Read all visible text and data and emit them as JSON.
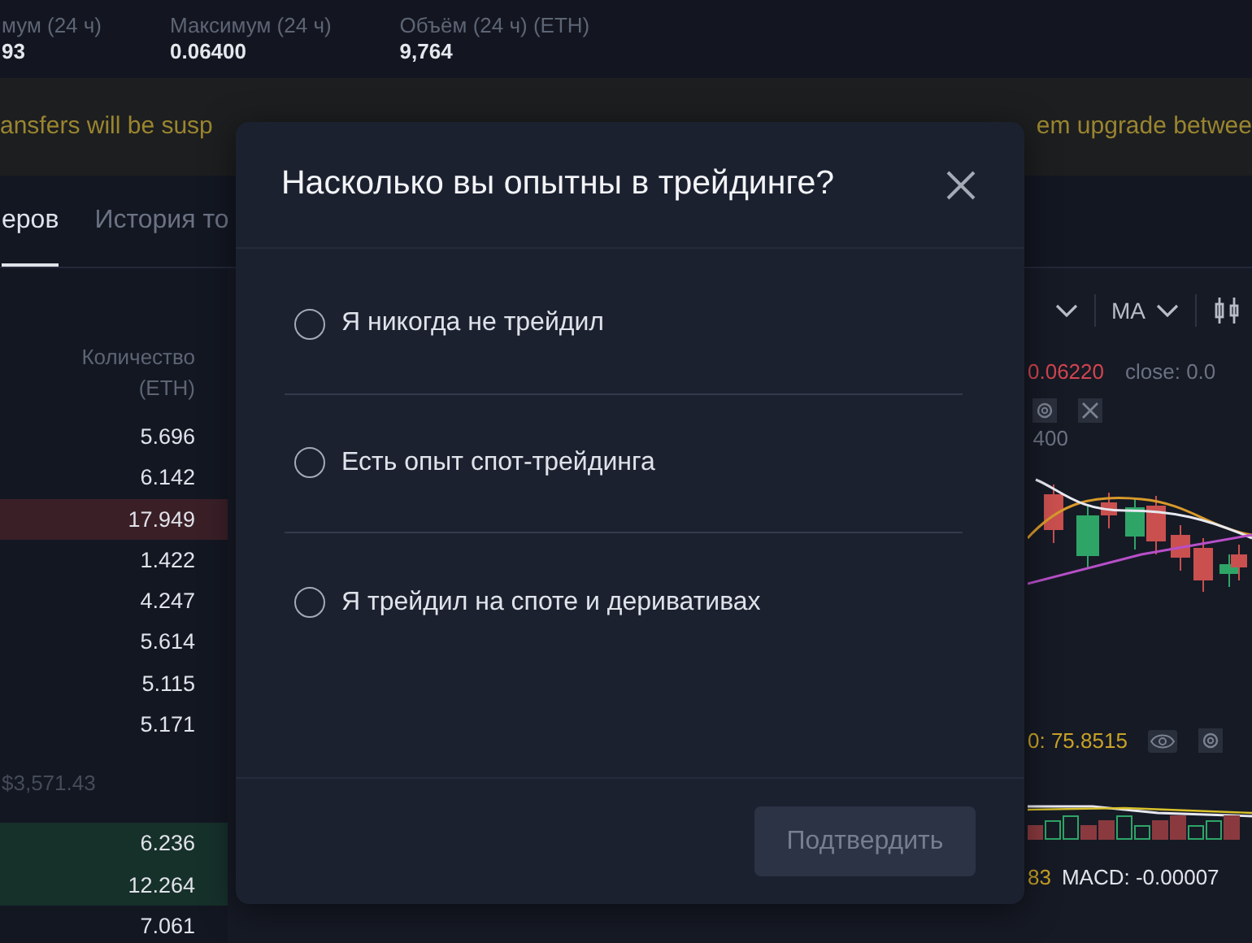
{
  "stats": [
    {
      "label": "мум (24 ч)",
      "value": "93"
    },
    {
      "label": "Максимум (24 ч)",
      "value": "0.06400"
    },
    {
      "label": "Объём (24 ч) (ETH)",
      "value": "9,764"
    }
  ],
  "banner": {
    "left": "ansfers will be susp",
    "right": "em upgrade betwee"
  },
  "tabs": [
    {
      "label": "еров",
      "selected": true
    },
    {
      "label": "История то",
      "selected": false
    }
  ],
  "order_book": {
    "header": "Количество (ETH)",
    "asks": [
      {
        "amount": "5.696",
        "highlighted": false
      },
      {
        "amount": "6.142",
        "highlighted": false
      },
      {
        "amount": "17.949",
        "highlighted": true
      },
      {
        "amount": "1.422",
        "highlighted": false
      },
      {
        "amount": "4.247",
        "highlighted": false
      },
      {
        "amount": "5.614",
        "highlighted": false
      },
      {
        "amount": "5.115",
        "highlighted": false
      },
      {
        "amount": "5.171",
        "highlighted": false
      }
    ],
    "mid_price": "$3,571.43",
    "bids": [
      {
        "amount": "6.236",
        "highlighted": true
      },
      {
        "amount": "12.264",
        "highlighted": true
      },
      {
        "amount": "7.061",
        "highlighted": false
      }
    ]
  },
  "chart": {
    "toolbar": [
      {
        "kind": "caret"
      },
      {
        "kind": "dropdown",
        "label": "MA"
      },
      {
        "kind": "candles"
      }
    ],
    "ohlc_value": "0.06220",
    "ohlc_next": "close: 0.0",
    "axis_label": "400",
    "rsi_label": "0: 75.8515",
    "macd_prefix": "83",
    "macd_label": "MACD: -0.00007"
  },
  "modal": {
    "title": "Насколько вы опытны в трейдинге?",
    "options": [
      {
        "label": "Я никогда не трейдил",
        "selected": false
      },
      {
        "label": "Есть опыт спот-трейдинга",
        "selected": false
      },
      {
        "label": "Я трейдил на споте и деривативах",
        "selected": false
      }
    ],
    "button": {
      "label": "Подтвердить",
      "disabled": true
    }
  }
}
